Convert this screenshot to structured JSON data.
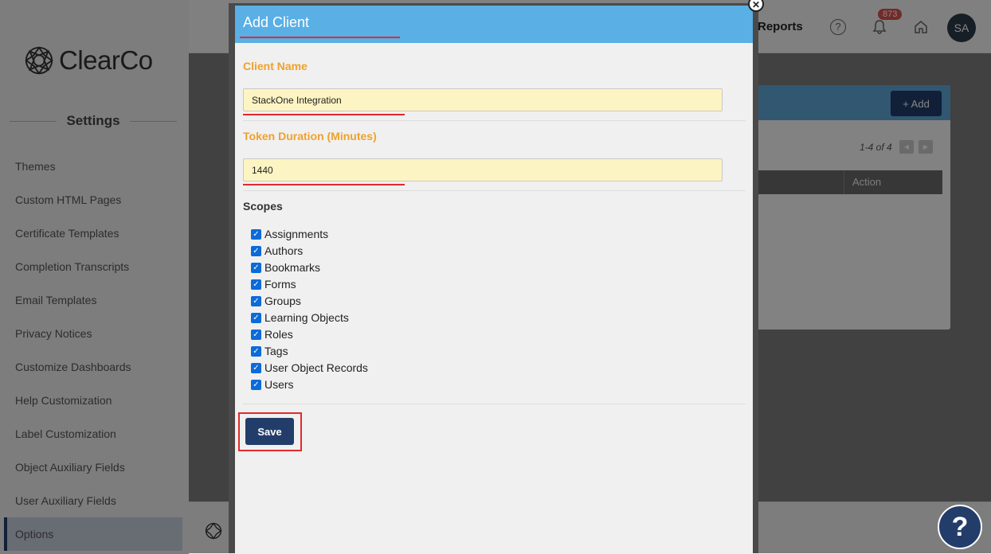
{
  "brand": {
    "name": "ClearCo"
  },
  "sidebar": {
    "heading": "Settings",
    "items": [
      {
        "label": "Themes"
      },
      {
        "label": "Custom HTML Pages"
      },
      {
        "label": "Certificate Templates"
      },
      {
        "label": "Completion Transcripts"
      },
      {
        "label": "Email Templates"
      },
      {
        "label": "Privacy Notices"
      },
      {
        "label": "Customize Dashboards"
      },
      {
        "label": "Help Customization"
      },
      {
        "label": "Label Customization"
      },
      {
        "label": "Object Auxiliary Fields"
      },
      {
        "label": "User Auxiliary Fields"
      },
      {
        "label": "Options"
      }
    ],
    "active_item": "Options"
  },
  "header": {
    "reports_label": "Reports",
    "help_icon": "help-circle-icon",
    "notifications": {
      "icon": "bell-icon",
      "count": "873"
    },
    "home_icon": "home-icon",
    "avatar_initials": "SA"
  },
  "background_panel": {
    "add_label": "+ Add",
    "pagination": "1-4 of 4",
    "column_action": "Action"
  },
  "modal": {
    "title": "Add Client",
    "close_icon": "close-circle-icon",
    "client_name": {
      "label": "Client Name",
      "value": "StackOne Integration"
    },
    "token_duration": {
      "label": "Token Duration (Minutes)",
      "value": "1440"
    },
    "scopes_label": "Scopes",
    "scopes": [
      {
        "label": "Assignments",
        "checked": true
      },
      {
        "label": "Authors",
        "checked": true
      },
      {
        "label": "Bookmarks",
        "checked": true
      },
      {
        "label": "Forms",
        "checked": true
      },
      {
        "label": "Groups",
        "checked": true
      },
      {
        "label": "Learning Objects",
        "checked": true
      },
      {
        "label": "Roles",
        "checked": true
      },
      {
        "label": "Tags",
        "checked": true
      },
      {
        "label": "User Object Records",
        "checked": true
      },
      {
        "label": "Users",
        "checked": true
      }
    ],
    "save_label": "Save"
  },
  "help_fab": {
    "label": "?"
  },
  "colors": {
    "primary": "#233d6b",
    "modal_header": "#5aafe5",
    "label_orange": "#f0a12c",
    "input_bg": "#fdf4c3",
    "annotation_red": "#e32a2a"
  }
}
